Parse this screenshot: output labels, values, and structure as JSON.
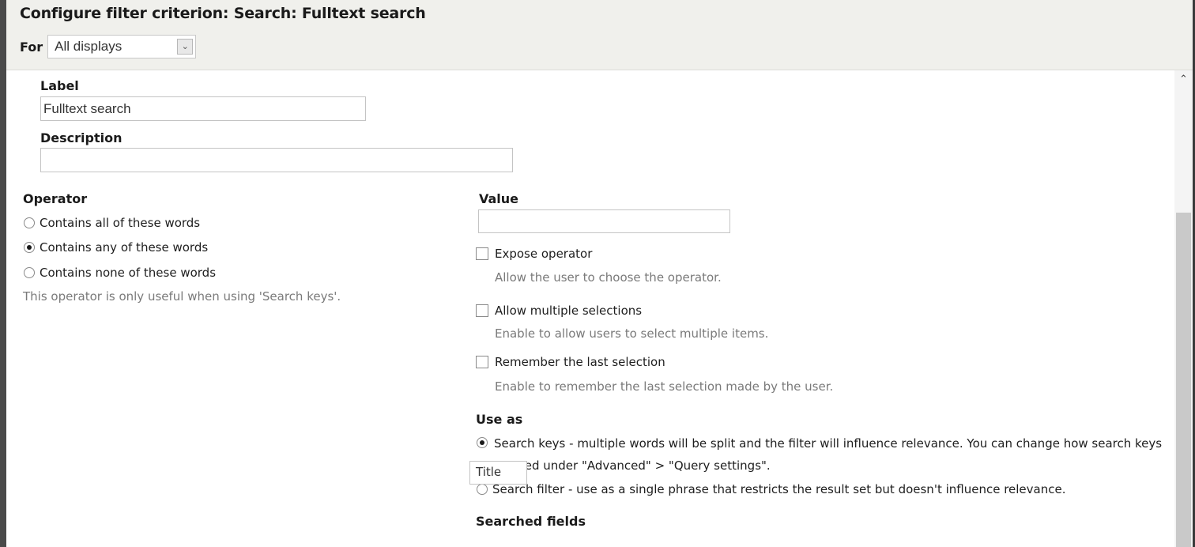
{
  "dialog": {
    "title": "Configure filter criterion: Search: Fulltext search",
    "for_label": "For",
    "for_select": {
      "selected": "All displays"
    }
  },
  "form": {
    "label": {
      "label": "Label",
      "value": "Fulltext search"
    },
    "description": {
      "label": "Description",
      "value": ""
    },
    "operator": {
      "label": "Operator",
      "options": [
        {
          "label": "Contains all of these words",
          "checked": false
        },
        {
          "label": "Contains any of these words",
          "checked": true
        },
        {
          "label": "Contains none of these words",
          "checked": false
        }
      ],
      "help": "This operator is only useful when using 'Search keys'."
    },
    "value": {
      "label": "Value",
      "value": ""
    },
    "checkboxes": [
      {
        "label": "Expose operator",
        "checked": false,
        "help": "Allow the user to choose the operator."
      },
      {
        "label": "Allow multiple selections",
        "checked": false,
        "help": "Enable to allow users to select multiple items."
      },
      {
        "label": "Remember the last selection",
        "checked": false,
        "help": "Enable to remember the last selection made by the user."
      }
    ],
    "use_as": {
      "label": "Use as",
      "options": [
        {
          "label": "Search keys - multiple words will be split and the filter will influence relevance. You can change how search keys are parsed under \"Advanced\" > \"Query settings\".",
          "checked": true
        },
        {
          "label": "Search filter - use as a single phrase that restricts the result set but doesn't influence relevance.",
          "checked": false
        }
      ]
    },
    "searched_fields": {
      "label": "Searched fields",
      "options": [
        "Title"
      ]
    }
  },
  "scrollbar": {
    "up_icon": "chevron-up"
  }
}
